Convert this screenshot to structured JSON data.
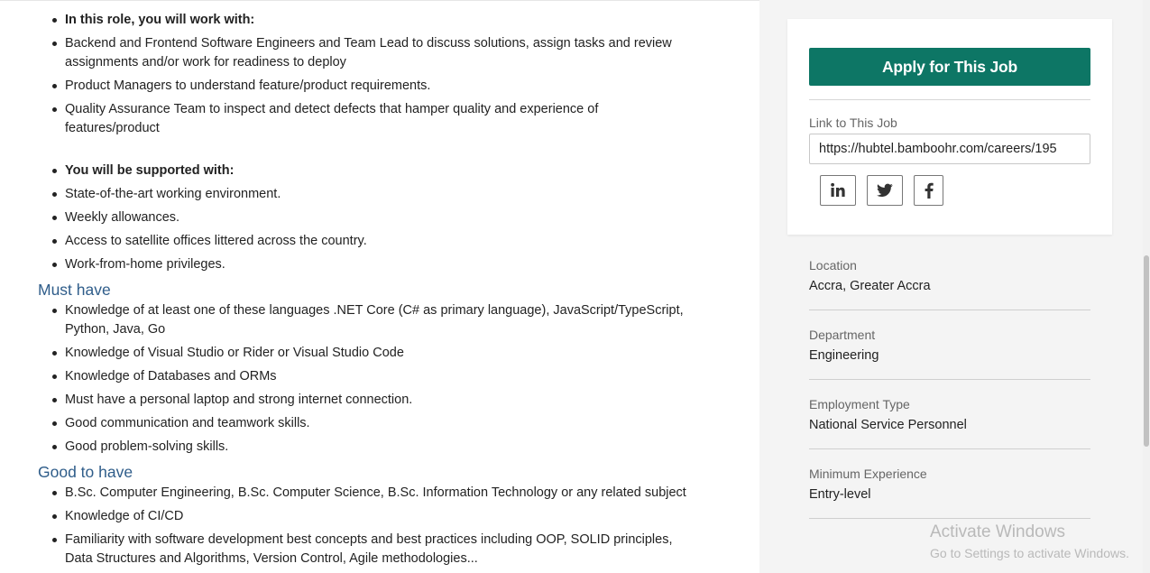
{
  "description": {
    "role_items": [
      "In this role, you will work with:",
      "Backend and Frontend Software Engineers and Team Lead to discuss solutions, assign tasks and review assignments and/or work for readiness to deploy",
      "Product Managers to understand feature/product requirements.",
      "Quality Assurance Team to inspect and detect defects that hamper quality and experience of features/product"
    ],
    "support_items": [
      "You will be supported with:",
      "State-of-the-art working environment.",
      "Weekly allowances.",
      "Access to satellite offices littered across the country.",
      "Work-from-home privileges."
    ],
    "must_have_heading": "Must have",
    "must_have_items": [
      "Knowledge of at least one of these languages .NET Core (C# as primary language), JavaScript/TypeScript, Python, Java, Go",
      "Knowledge of Visual Studio or Rider or Visual Studio Code",
      "Knowledge of Databases and ORMs",
      "Must have a personal laptop and strong internet connection.",
      "Good communication and teamwork skills.",
      "Good problem-solving skills."
    ],
    "good_to_have_heading": "Good to have",
    "good_to_have_items": [
      "B.Sc. Computer Engineering, B.Sc. Computer Science, B.Sc. Information Technology or any related subject",
      "Knowledge of CI/CD",
      "Familiarity with software development best concepts and best practices including OOP, SOLID principles, Data Structures and Algorithms, Version Control, Agile methodologies..."
    ]
  },
  "sidebar": {
    "apply_label": "Apply for This Job",
    "link_label": "Link to This Job",
    "link_value": "https://hubtel.bamboohr.com/careers/195",
    "social": [
      "linkedin-icon",
      "twitter-icon",
      "facebook-icon"
    ],
    "accent_color": "#0d7665",
    "details": [
      {
        "label": "Location",
        "value": "Accra, Greater Accra"
      },
      {
        "label": "Department",
        "value": "Engineering"
      },
      {
        "label": "Employment Type",
        "value": "National Service Personnel"
      },
      {
        "label": "Minimum Experience",
        "value": "Entry-level"
      }
    ]
  },
  "watermark": {
    "title": "Activate Windows",
    "subtitle": "Go to Settings to activate Windows."
  }
}
